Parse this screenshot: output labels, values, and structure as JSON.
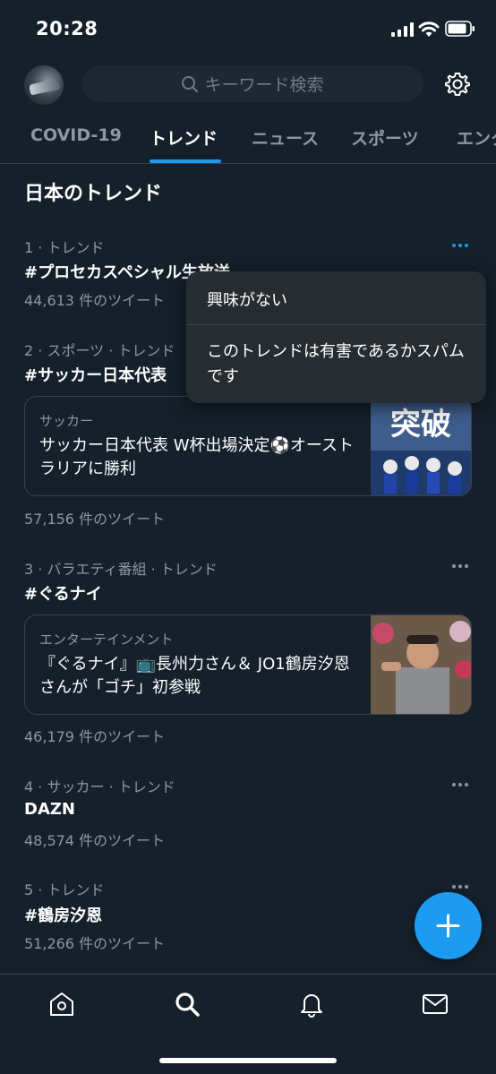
{
  "status_bar": {
    "time": "20:28"
  },
  "search": {
    "placeholder": "キーワード検索"
  },
  "tabs": [
    {
      "label": "COVID-19"
    },
    {
      "label": "トレンド",
      "active": true
    },
    {
      "label": "ニュース"
    },
    {
      "label": "スポーツ"
    },
    {
      "label": "エンタ"
    }
  ],
  "section": {
    "title": "日本のトレンド"
  },
  "trends": [
    {
      "meta": "1 · トレンド",
      "name": "#プロセカスペシャル生放送",
      "count": "44,613 件のツイート"
    },
    {
      "meta": "2 · スポーツ · トレンド",
      "name": "#サッカー日本代表",
      "count": "57,156 件のツイート",
      "card": {
        "category": "サッカー",
        "text": "サッカー日本代表 W杯出場決定⚽オーストラリアに勝利",
        "thumb_text": "突破"
      }
    },
    {
      "meta": "3 · バラエティ番組 · トレンド",
      "name": "#ぐるナイ",
      "count": "46,179 件のツイート",
      "card": {
        "category": "エンターテインメント",
        "text": "『ぐるナイ』📺長州力さん＆ JO1鶴房汐恩さんが「ゴチ」初参戦"
      }
    },
    {
      "meta": "4 · サッカー · トレンド",
      "name": "DAZN",
      "count": "48,574 件のツイート"
    },
    {
      "meta": "5 · トレンド",
      "name": "#鶴房汐恩",
      "count": "51,266 件のツイート"
    }
  ],
  "popup_menu": {
    "items": [
      {
        "label": "興味がない"
      },
      {
        "label": "このトレンドは有害であるかスパムです"
      }
    ]
  },
  "colors": {
    "background": "#15202b",
    "accent": "#1d9bf0",
    "secondary_text": "#8b98a5",
    "popup": "#272c31"
  },
  "icons": [
    "signal-icon",
    "wifi-icon",
    "battery-icon",
    "search-icon",
    "gear-icon",
    "more-icon",
    "compose-icon",
    "home-icon",
    "explore-icon",
    "notifications-icon",
    "messages-icon"
  ]
}
